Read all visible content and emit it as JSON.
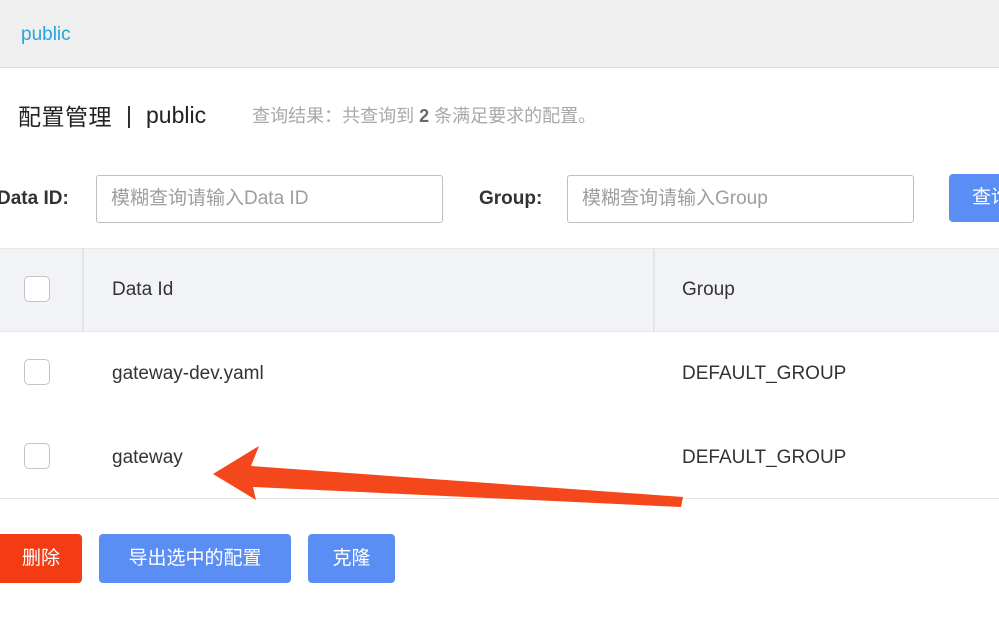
{
  "namespace_bar": {
    "link": "public"
  },
  "title": {
    "main": "配置管理",
    "separator": "|",
    "namespace": "public",
    "result_prefix": "查询结果：共查询到",
    "result_count": "2",
    "result_suffix": "条满足要求的配置。"
  },
  "search": {
    "data_id_label": "Data ID:",
    "data_id_placeholder": "模糊查询请输入Data ID",
    "group_label": "Group:",
    "group_placeholder": "模糊查询请输入Group",
    "query_button": "查询"
  },
  "table": {
    "columns": [
      "Data Id",
      "Group"
    ],
    "rows": [
      {
        "data_id": "gateway-dev.yaml",
        "group": "DEFAULT_GROUP"
      },
      {
        "data_id": "gateway",
        "group": "DEFAULT_GROUP"
      }
    ]
  },
  "actions": {
    "delete": "删除",
    "export": "导出选中的配置",
    "clone": "克隆"
  },
  "colors": {
    "primary": "#5a8ef5",
    "danger": "#f43c14",
    "link": "#25a5d8",
    "annotation_arrow": "#f4471b"
  },
  "annotation": {
    "type": "arrow",
    "points_to": "gateway"
  }
}
